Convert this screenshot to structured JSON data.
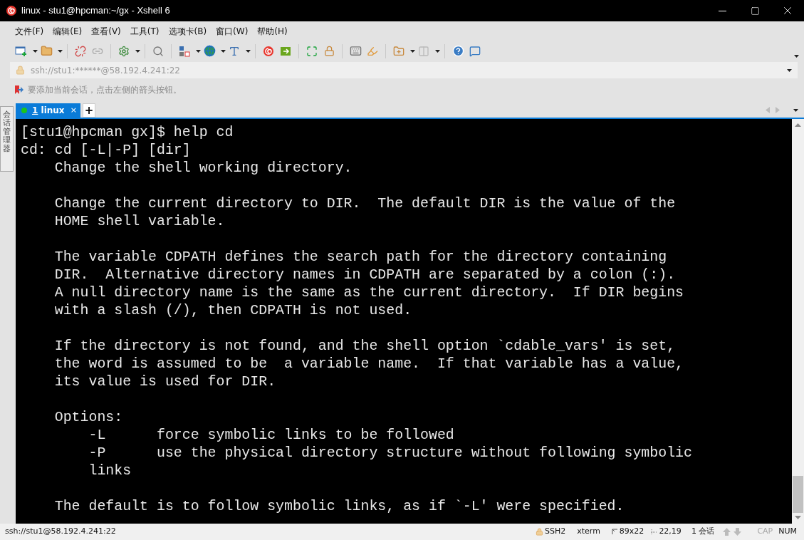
{
  "window": {
    "title": "linux - stu1@hpcman:~/gx - Xshell 6"
  },
  "menu": [
    "文件(F)",
    "编辑(E)",
    "查看(V)",
    "工具(T)",
    "选项卡(B)",
    "窗口(W)",
    "帮助(H)"
  ],
  "address_bar": {
    "value": "ssh://stu1:******@58.192.4.241:22"
  },
  "hint_bar": {
    "text": "要添加当前会话，点击左侧的箭头按钮。"
  },
  "side_panel": {
    "label": "会话管理器"
  },
  "tabs": [
    {
      "number": "1",
      "label": "linux",
      "close": "×",
      "connected": true,
      "selected": true
    }
  ],
  "new_tab": "+",
  "terminal": {
    "blocks": [
      [
        "[stu1@hpcman gx]$ help cd",
        "cd: cd [-L|-P] [dir]",
        "    Change the shell working directory."
      ],
      [
        "    Change the current directory to DIR.  The default DIR is the value of the",
        "    HOME shell variable."
      ],
      [
        "    The variable CDPATH defines the search path for the directory containing",
        "    DIR.  Alternative directory names in CDPATH are separated by a colon (:).",
        "    A null directory name is the same as the current directory.  If DIR begins",
        "    with a slash (/), then CDPATH is not used."
      ],
      [
        "    If the directory is not found, and the shell option `cdable_vars' is set,",
        "    the word is assumed to be  a variable name.  If that variable has a value,",
        "    its value is used for DIR."
      ],
      [
        "    Options:",
        "        -L      force symbolic links to be followed",
        "        -P      use the physical directory structure without following symbolic",
        "        links"
      ],
      [
        "    The default is to follow symbolic links, as if `-L' were specified."
      ]
    ]
  },
  "status_bar": {
    "connection": "ssh://stu1@58.192.4.241:22",
    "protocol": "SSH2",
    "terminal_type": "xterm",
    "size": "89x22",
    "cursor": "22,19",
    "sessions": "1 会话",
    "indicators": [
      {
        "label": "CAP",
        "on": false
      },
      {
        "label": "NUM",
        "on": true
      }
    ]
  }
}
